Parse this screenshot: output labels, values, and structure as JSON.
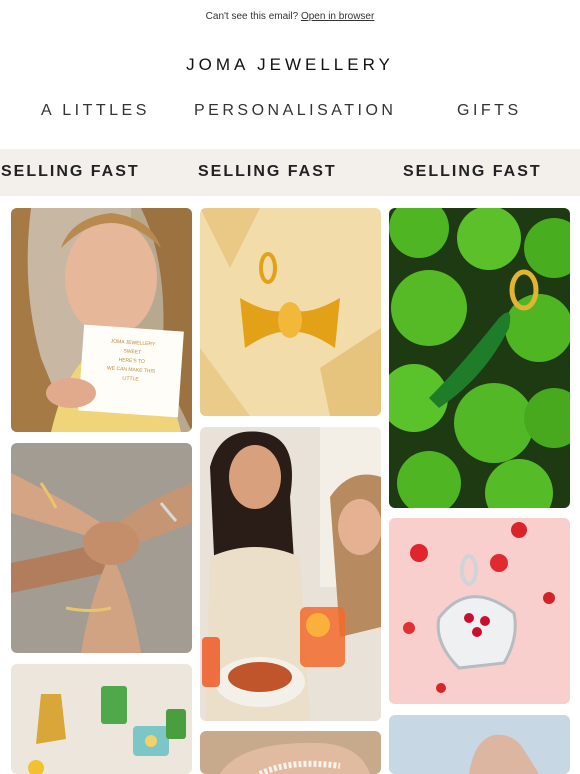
{
  "preheader": {
    "text": "Can't see this email?",
    "link": "Open in browser"
  },
  "brand": "JOMA JEWELLERY",
  "nav": {
    "items": [
      "A LITTLES",
      "PERSONALISATION",
      "GIFTS"
    ]
  },
  "ticker": {
    "items": [
      "SELLING FAST",
      "SELLING FAST",
      "SELLING FAST"
    ]
  },
  "gallery": {
    "card_text": [
      "JOMA JEWELLERY",
      "SWEET",
      "HERE'S TO",
      "WE CAN MAKE THIS",
      "LITTLE"
    ],
    "tiles": [
      {
        "name": "woman-with-gift-card",
        "icon": "photo-icon"
      },
      {
        "name": "farfalle-pasta-charm",
        "icon": "photo-icon"
      },
      {
        "name": "pea-pod-charm-on-peas",
        "icon": "photo-icon"
      },
      {
        "name": "stacked-bracelets-hands",
        "icon": "photo-icon"
      },
      {
        "name": "friends-eating-spaghetti",
        "icon": "photo-icon"
      },
      {
        "name": "cake-charm-on-pink",
        "icon": "photo-icon"
      },
      {
        "name": "assorted-enamel-charms",
        "icon": "photo-icon"
      },
      {
        "name": "pearl-bracelet-wrist",
        "icon": "photo-icon"
      },
      {
        "name": "hand-on-blue-background",
        "icon": "photo-icon"
      }
    ]
  },
  "colors": {
    "ticker_bg": "#f3f0ec",
    "pea_green": "#4fb523",
    "gold": "#e3a118",
    "pink_bg": "#f8cfcd"
  }
}
